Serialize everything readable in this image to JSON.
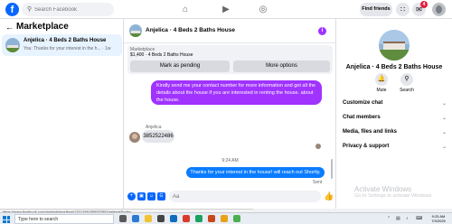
{
  "topbar": {
    "logo": "f",
    "search_placeholder": "Search Facebook",
    "nav_icons": [
      "home-icon",
      "video-icon",
      "groups-icon"
    ],
    "find_friends": "Find friends",
    "notification_count": "4"
  },
  "left": {
    "title": "Marketplace",
    "conversation": {
      "title": "Anjelica · 4 Beds 2 Baths House",
      "preview": "You: Thanks for your interest in the h... · 1w"
    }
  },
  "chat": {
    "title": "Anjelica · 4 Beds 2 Baths House",
    "listing_label": "Marketplace",
    "listing_price": "$1,400 · 4 Beds 2 Baths House",
    "mark_pending": "Mark as pending",
    "more_options": "More options",
    "outgoing_1": "Kindly send me your contact number for more information and get all the details about the house if you are interested in renting the house. about the house.",
    "sender_name": "Anjelica",
    "incoming_1": "3852522486",
    "timestamp": "9:24 AM",
    "outgoing_2": "Thanks for your interest in the house! will reach out Shortly.",
    "sent_label": "Sent",
    "input_placeholder": "Aa"
  },
  "right": {
    "title": "Anjelica · 4 Beds 2 Baths House",
    "mute_label": "Mute",
    "search_label": "Search",
    "rows": [
      "Customize chat",
      "Chat members",
      "Media, files and links",
      "Privacy & support"
    ]
  },
  "watermark": {
    "line1": "Activate Windows",
    "line2": "Go to Settings to activate Windows."
  },
  "status_url": "https://www.facebook.com/marketplace/item/1311348185933288/?referralSurfac...",
  "taskbar": {
    "search_text": "Type here to search",
    "time": "9:25 AM",
    "date": "7/3/2025"
  },
  "colors": {
    "brand": "#0866ff",
    "outgoing_purple": "#a033ff",
    "outgoing_blue": "#0a7cff"
  }
}
